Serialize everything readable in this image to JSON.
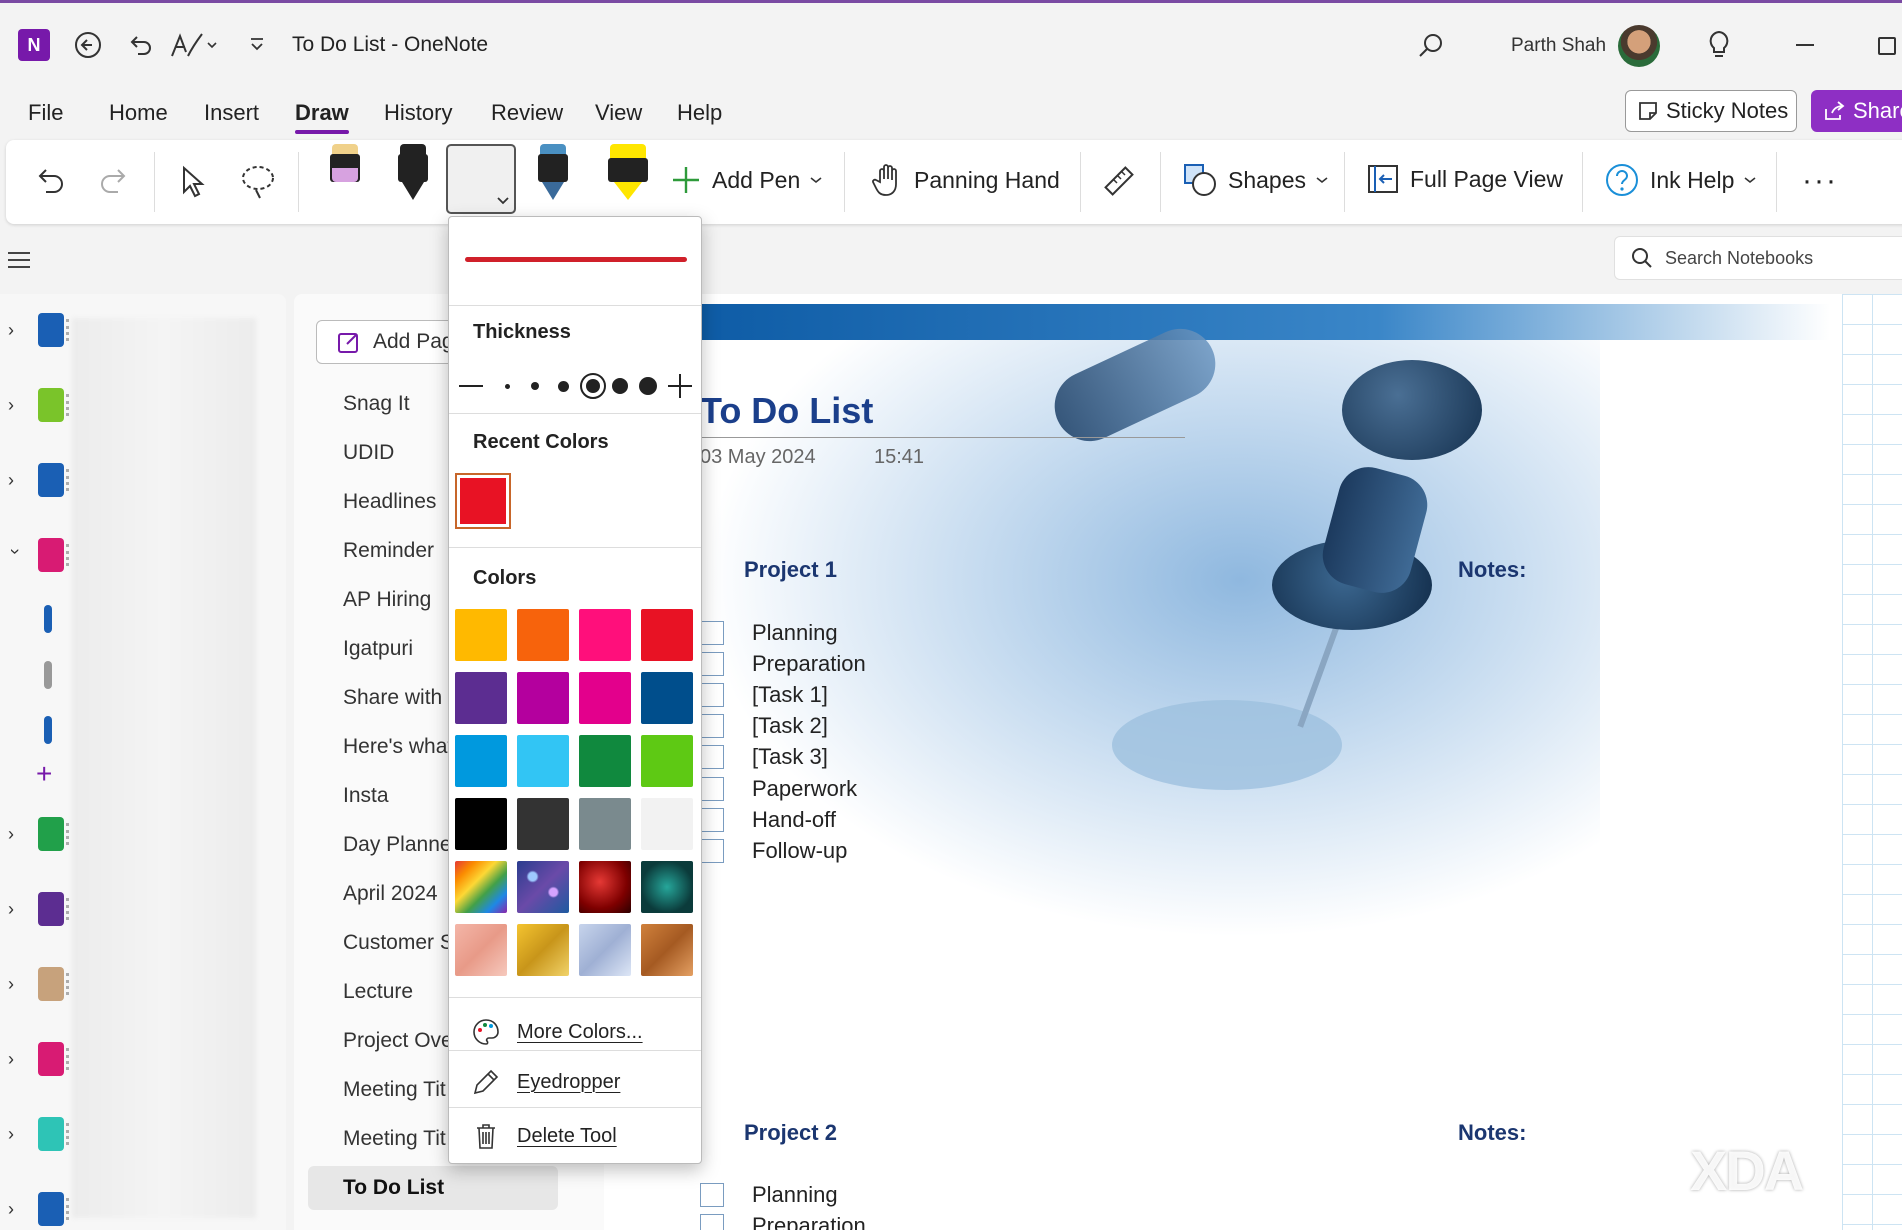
{
  "titlebar": {
    "doc_title": "To Do List  -  OneNote",
    "user_name": "Parth Shah"
  },
  "menu": {
    "items": [
      "File",
      "Home",
      "Insert",
      "Draw",
      "History",
      "Review",
      "View",
      "Help"
    ],
    "active": "Draw",
    "sticky_notes": "Sticky Notes",
    "share": "Share"
  },
  "ribbon": {
    "add_pen": "Add Pen",
    "panning_hand": "Panning Hand",
    "shapes": "Shapes",
    "full_page_view": "Full Page View",
    "ink_help": "Ink Help"
  },
  "search": {
    "placeholder": "Search Notebooks"
  },
  "pages": {
    "add_page": "Add Page",
    "items": [
      "Snag It",
      "UDID",
      "Headlines",
      "Reminder",
      "AP Hiring",
      "Igatpuri",
      "Share with",
      "Here's what",
      "Insta",
      "Day Planner",
      "April 2024",
      "Customer S",
      "Lecture",
      "Project Ove",
      "Meeting Tit",
      "Meeting Tit",
      "To Do List"
    ],
    "current": "To Do List"
  },
  "note": {
    "title": "To Do List",
    "date": "03 May 2024",
    "time": "15:41",
    "project1": "Project 1",
    "project2": "Project 2",
    "notes_label": "Notes:",
    "tasks": [
      "Planning",
      "Preparation",
      "[Task 1]",
      "[Task 2]",
      "[Task 3]",
      "Paperwork",
      "Hand-off",
      "Follow-up"
    ],
    "tasks2": [
      "Planning",
      "Preparation"
    ]
  },
  "flyout": {
    "thickness": "Thickness",
    "recent_colors": "Recent Colors",
    "colors": "Colors",
    "more_colors": "More Colors...",
    "eyedropper": "Eyedropper",
    "delete_tool": "Delete Tool",
    "pen_color": "#e81224",
    "recent_color": "#e81224",
    "palette": [
      "#ffb900",
      "#f7630c",
      "#ff0f7b",
      "#e81224",
      "#5c2d91",
      "#b4009e",
      "#e3008c",
      "#004e8c",
      "#0099de",
      "#32c5f4",
      "#10893e",
      "#5ec914",
      "#000000",
      "#333333",
      "#7a8a8e",
      "#f2f2f2"
    ],
    "textures": [
      "rainbow",
      "galaxy",
      "lava",
      "ocean",
      "rose-gold",
      "gold",
      "silver",
      "bronze"
    ]
  },
  "watermark": "XDA",
  "notebook_colors": [
    "#1a5fb4",
    "#7ac42a",
    "#1a5fb4",
    "#d81b73",
    "#21a04a",
    "#5c2d91",
    "#c7a27c",
    "#d81b73",
    "#2ec4b6",
    "#1a5fb4"
  ]
}
